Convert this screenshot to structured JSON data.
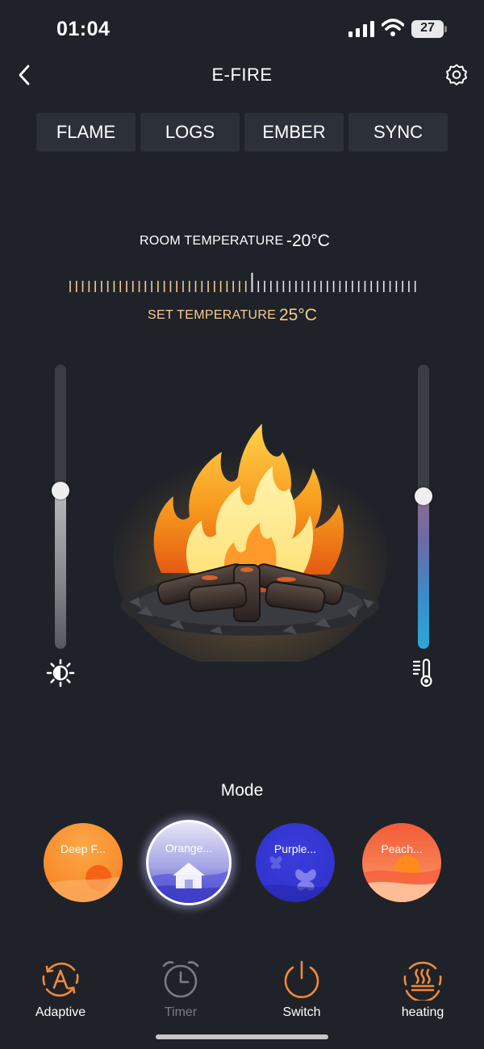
{
  "status_bar": {
    "time": "01:04",
    "battery": "27"
  },
  "header": {
    "title": "E-FIRE",
    "back_icon": "chevron-left-icon",
    "settings_icon": "gear-icon"
  },
  "tabs": [
    {
      "label": "FLAME"
    },
    {
      "label": "LOGS"
    },
    {
      "label": "EMBER"
    },
    {
      "label": "SYNC"
    }
  ],
  "temperature": {
    "room_label": "ROOM TEMPERATURE",
    "room_value": "-20°C",
    "set_label": "SET TEMPERATURE",
    "set_value": "25°C"
  },
  "sliders": {
    "brightness_level": 0.44,
    "heat_level": 0.46,
    "brightness_icon": "brightness-icon",
    "heat_icon": "thermometer-icon"
  },
  "mode": {
    "label": "Mode",
    "options": [
      {
        "label": "Deep F...",
        "selected": false
      },
      {
        "label": "Orange...",
        "selected": true
      },
      {
        "label": "Purple...",
        "selected": false
      },
      {
        "label": "Peach...",
        "selected": false
      }
    ]
  },
  "bottom_bar": [
    {
      "label": "Adaptive",
      "icon": "adaptive-icon",
      "color": "#f08a3c"
    },
    {
      "label": "Timer",
      "icon": "alarm-clock-icon",
      "color": "#7a7c80"
    },
    {
      "label": "Switch",
      "icon": "power-icon",
      "color": "#f08a3c"
    },
    {
      "label": "heating",
      "icon": "heating-icon",
      "color": "#f08a3c"
    }
  ],
  "colors": {
    "background": "#1f2228",
    "accent": "#f08a3c",
    "set_temperature": "#f5cc93",
    "tab_background": "#2c3038"
  }
}
